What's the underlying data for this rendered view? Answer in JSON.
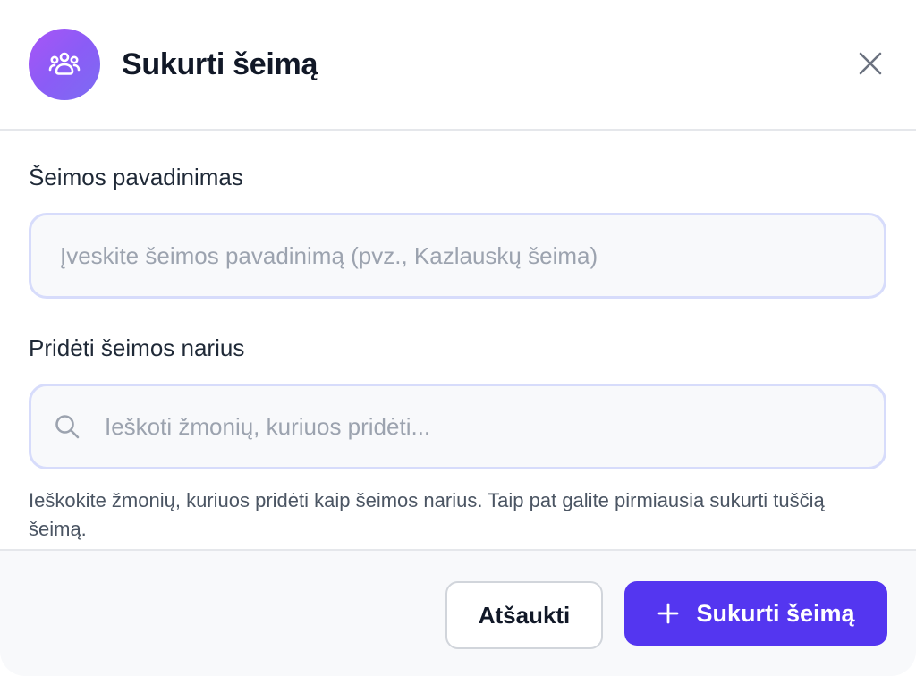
{
  "dialog": {
    "title": "Sukurti šeimą",
    "header_icon": "family-group-icon",
    "close_icon": "close-icon"
  },
  "form": {
    "family_name": {
      "label": "Šeimos pavadinimas",
      "value": "",
      "placeholder": "Įveskite šeimos pavadinimą (pvz., Kazlauskų šeima)"
    },
    "members": {
      "label": "Pridėti šeimos narius",
      "value": "",
      "placeholder": "Ieškoti žmonių, kuriuos pridėti...",
      "search_icon": "search-icon",
      "hint": "Ieškokite žmonių, kuriuos pridėti kaip šeimos narius. Taip pat galite pirmiausia sukurti tuščią šeimą."
    }
  },
  "footer": {
    "cancel_label": "Atšaukti",
    "create_label": "Sukurti šeimą",
    "create_icon": "plus-icon"
  },
  "colors": {
    "accent": "#5436f0",
    "icon_gradient_start": "#a855f7",
    "icon_gradient_end": "#7c6cf2",
    "input_border": "#d7dcfb"
  }
}
